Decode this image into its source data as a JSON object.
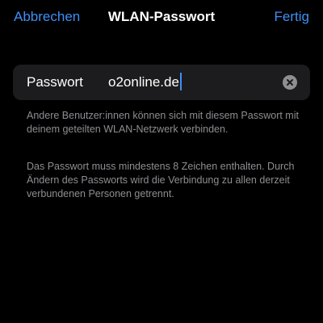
{
  "nav": {
    "cancel_label": "Abbrechen",
    "title": "WLAN-Passwort",
    "done_label": "Fertig"
  },
  "password_field": {
    "label": "Passwort",
    "value": "o2online.de",
    "clear_icon": "clear-circle-x-icon"
  },
  "footer": {
    "info_1": "Andere Benutzer:innen können sich mit diesem Passwort mit deinem geteilten WLAN-Netzwerk verbinden.",
    "info_2": "Das Passwort muss mindestens 8 Zeichen enthalten. Durch Ändern des Passworts wird die Verbindung zu allen derzeit verbundenen Personen getrennt."
  },
  "colors": {
    "accent": "#3e8ff5",
    "background": "#000000",
    "card": "#1c1c1e",
    "secondary_text": "#8e8e93"
  }
}
